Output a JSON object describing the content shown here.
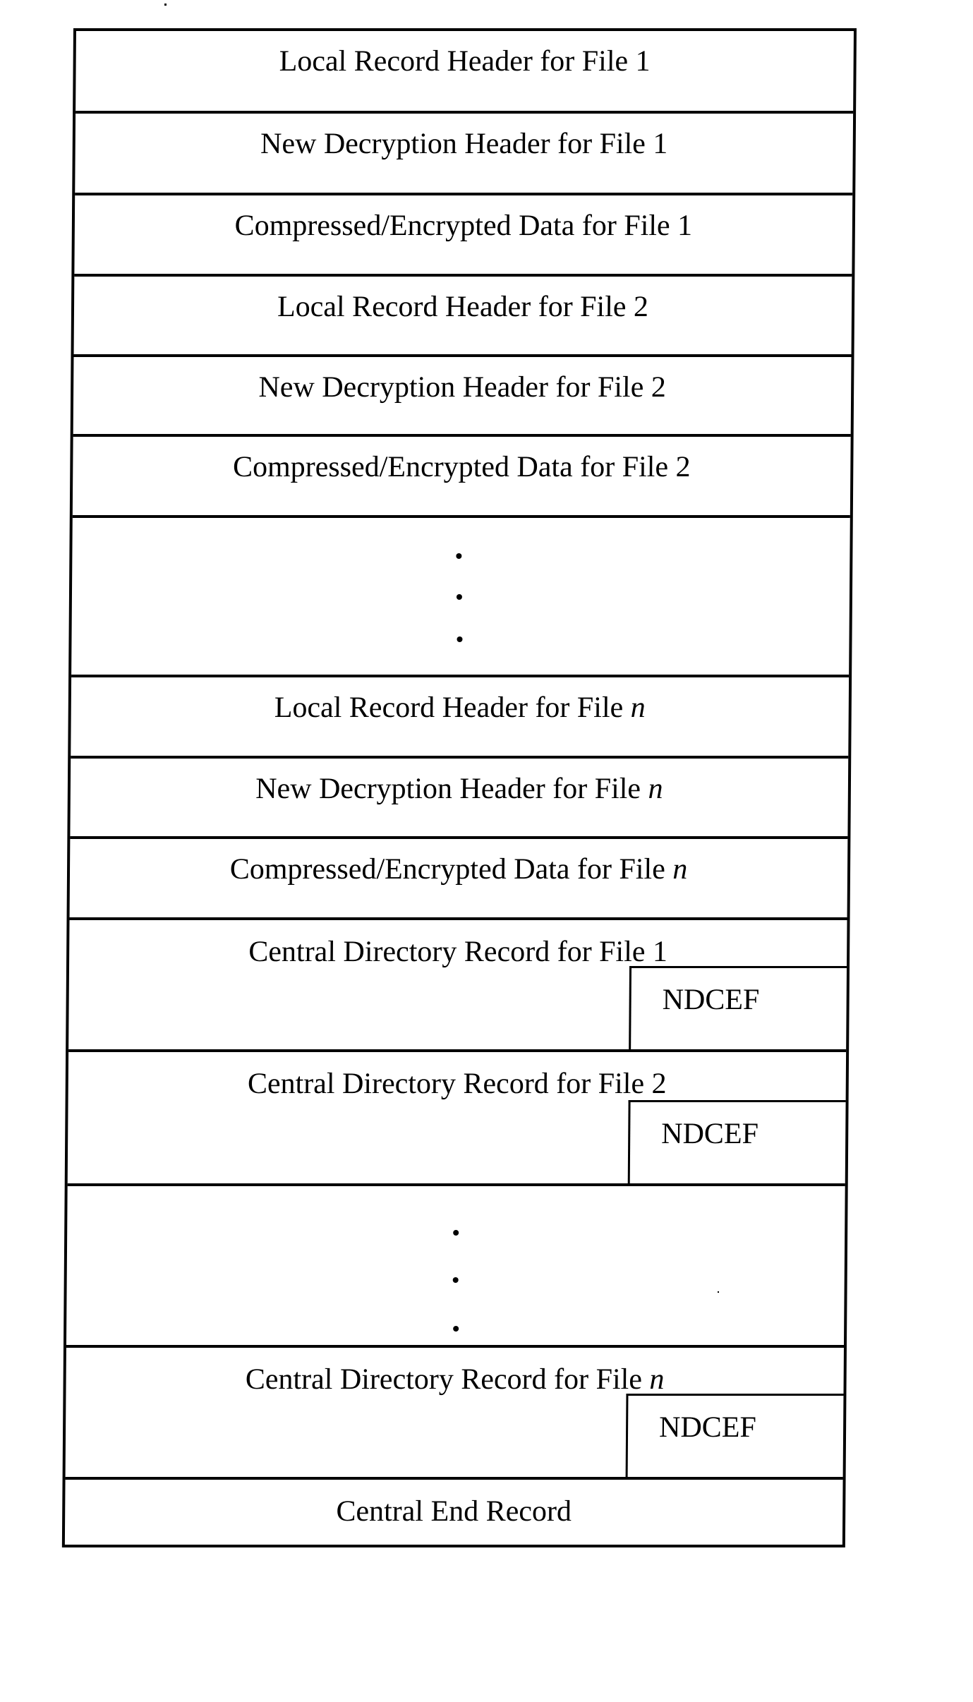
{
  "diagram": {
    "title": "",
    "blocks": [
      {
        "kind": "simple",
        "label": "Local Record Header for File ",
        "suffix": "1",
        "suffix_italic": false
      },
      {
        "kind": "simple",
        "label": "New Decryption Header for File ",
        "suffix": "1",
        "suffix_italic": false
      },
      {
        "kind": "simple",
        "label": "Compressed/Encrypted Data for File ",
        "suffix": "1",
        "suffix_italic": false
      },
      {
        "kind": "simple",
        "label": "Local Record Header for File ",
        "suffix": "2",
        "suffix_italic": false
      },
      {
        "kind": "simple",
        "label": "New Decryption Header for File ",
        "suffix": "2",
        "suffix_italic": false
      },
      {
        "kind": "simple",
        "label": "Compressed/Encrypted Data for File ",
        "suffix": "2",
        "suffix_italic": false
      },
      {
        "kind": "ellipsis",
        "label": "vertical-ellipsis"
      },
      {
        "kind": "simple",
        "label": "Local Record Header for File ",
        "suffix": "n",
        "suffix_italic": true
      },
      {
        "kind": "simple",
        "label": "New Decryption Header for File ",
        "suffix": "n",
        "suffix_italic": true
      },
      {
        "kind": "simple",
        "label": "Compressed/Encrypted Data for File ",
        "suffix": "n",
        "suffix_italic": true
      },
      {
        "kind": "central",
        "label": "Central Directory Record for File ",
        "suffix": "1",
        "suffix_italic": false,
        "sub_field": "NDCEF"
      },
      {
        "kind": "central",
        "label": "Central Directory Record for File ",
        "suffix": "2",
        "suffix_italic": false,
        "sub_field": "NDCEF"
      },
      {
        "kind": "ellipsis",
        "label": "vertical-ellipsis"
      },
      {
        "kind": "central",
        "label": "Central Directory Record for File ",
        "suffix": "n",
        "suffix_italic": true,
        "sub_field": "NDCEF"
      },
      {
        "kind": "simple",
        "label": "Central End Record",
        "suffix": "",
        "suffix_italic": false
      }
    ]
  }
}
